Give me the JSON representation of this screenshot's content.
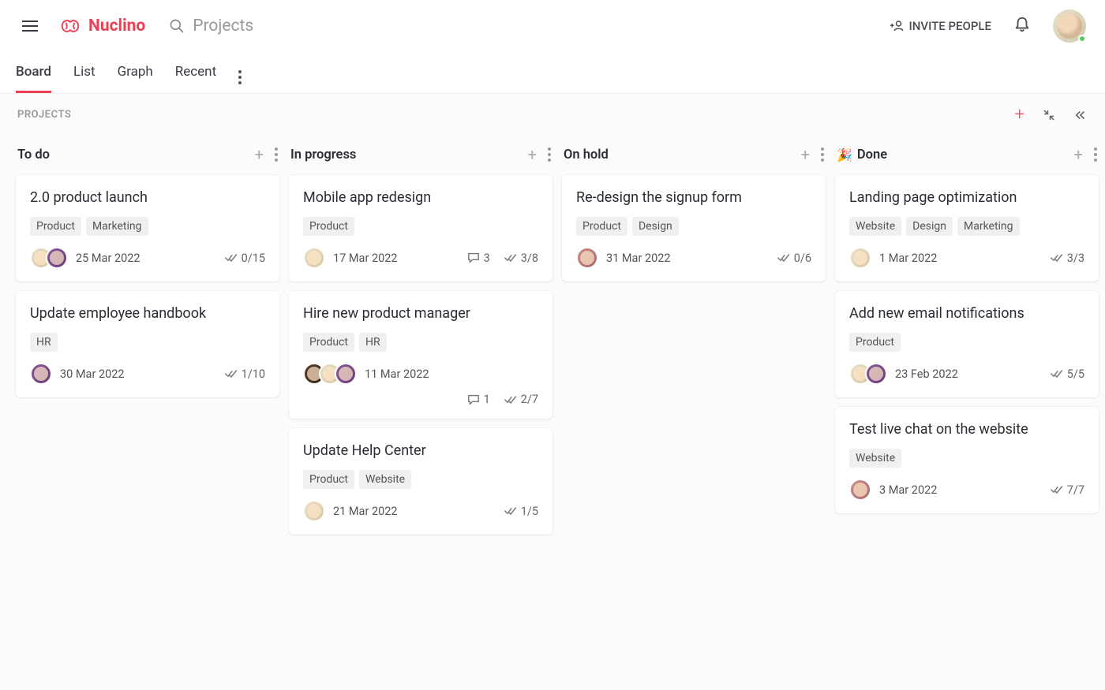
{
  "app": {
    "name": "Nuclino"
  },
  "search": {
    "placeholder": "Projects"
  },
  "header": {
    "invite": "INVITE PEOPLE"
  },
  "tabs": [
    "Board",
    "List",
    "Graph",
    "Recent"
  ],
  "active_tab": 0,
  "board_title": "PROJECTS",
  "columns": [
    {
      "title": "To do",
      "icon": "",
      "cards": [
        {
          "title": "2.0 product launch",
          "tags": [
            "Product",
            "Marketing"
          ],
          "avatars": [
            "a1",
            "a2"
          ],
          "date": "25 Mar 2022",
          "comments": null,
          "checklist": "0/15"
        },
        {
          "title": "Update employee handbook",
          "tags": [
            "HR"
          ],
          "avatars": [
            "a2"
          ],
          "date": "30 Mar 2022",
          "comments": null,
          "checklist": "1/10"
        }
      ]
    },
    {
      "title": "In progress",
      "icon": "",
      "cards": [
        {
          "title": "Mobile app redesign",
          "tags": [
            "Product"
          ],
          "avatars": [
            "a1"
          ],
          "date": "17 Mar 2022",
          "comments": "3",
          "checklist": "3/8"
        },
        {
          "title": "Hire new product manager",
          "tags": [
            "Product",
            "HR"
          ],
          "avatars": [
            "a4",
            "a1",
            "a2"
          ],
          "date": "11 Mar 2022",
          "comments": "1",
          "checklist": "2/7",
          "wrap_meta": true
        },
        {
          "title": "Update Help Center",
          "tags": [
            "Product",
            "Website"
          ],
          "avatars": [
            "a1"
          ],
          "date": "21 Mar 2022",
          "comments": null,
          "checklist": "1/5"
        }
      ]
    },
    {
      "title": "On hold",
      "icon": "",
      "cards": [
        {
          "title": "Re-design the signup form",
          "tags": [
            "Product",
            "Design"
          ],
          "avatars": [
            "a3"
          ],
          "date": "31 Mar 2022",
          "comments": null,
          "checklist": "0/6"
        }
      ]
    },
    {
      "title": "Done",
      "icon": "🎉",
      "cards": [
        {
          "title": "Landing page optimization",
          "tags": [
            "Website",
            "Design",
            "Marketing"
          ],
          "avatars": [
            "a1"
          ],
          "date": "1 Mar 2022",
          "comments": null,
          "checklist": "3/3"
        },
        {
          "title": "Add new email notifications",
          "tags": [
            "Product"
          ],
          "avatars": [
            "a1",
            "a2"
          ],
          "date": "23 Feb 2022",
          "comments": null,
          "checklist": "5/5"
        },
        {
          "title": "Test live chat on the website",
          "tags": [
            "Website"
          ],
          "avatars": [
            "a3"
          ],
          "date": "3 Mar 2022",
          "comments": null,
          "checklist": "7/7"
        }
      ]
    }
  ]
}
